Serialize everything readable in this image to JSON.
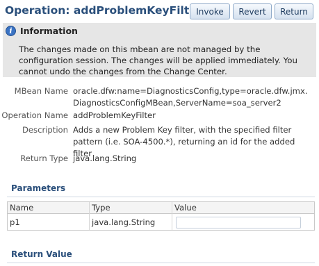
{
  "page": {
    "title": "Operation: addProblemKeyFilter"
  },
  "toolbar": {
    "invoke_label": "Invoke",
    "revert_label": "Revert",
    "return_label": "Return"
  },
  "info": {
    "icon_glyph": "i",
    "title": "Information",
    "message": "The changes made on this mbean are not managed by the configuration session. The changes will be applied immediately. You cannot undo the changes from the Change Center."
  },
  "details": {
    "mbean_name_label": "MBean Name",
    "mbean_name_line1": "oracle.dfw:name=DiagnosticsConfig,type=oracle.dfw.jmx.",
    "mbean_name_line2": "DiagnosticsConfigMBean,ServerName=soa_server2",
    "operation_name_label": "Operation Name",
    "operation_name_value": "addProblemKeyFilter",
    "description_label": "Description",
    "description_value": "Adds a new Problem Key filter, with the specified filter pattern (i.e. SOA-4500.*), returning an id for the added filter",
    "return_type_label": "Return Type",
    "return_type_value": "java.lang.String"
  },
  "parameters": {
    "section_title": "Parameters",
    "columns": [
      "Name",
      "Type",
      "Value"
    ],
    "rows": [
      {
        "name": "p1",
        "type": "java.lang.String",
        "value": ""
      }
    ]
  },
  "return_value": {
    "section_title": "Return Value"
  },
  "colors": {
    "title_blue": "#2a4f7b",
    "info_background": "#e6e6e6",
    "info_icon_blue": "#3a73c4"
  }
}
